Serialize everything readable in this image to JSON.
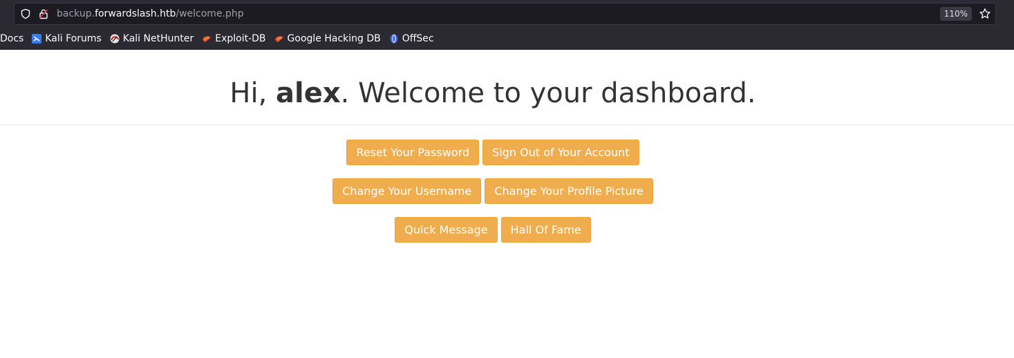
{
  "browser": {
    "url_prefix": "backup.",
    "url_host": "forwardslash.htb",
    "url_path": "/welcome.php",
    "zoom": "110%",
    "bookmarks": [
      {
        "label": "Docs",
        "icon": "none"
      },
      {
        "label": "Kali Forums",
        "icon": "kali-forums-icon"
      },
      {
        "label": "Kali NetHunter",
        "icon": "kali-nethunter-icon"
      },
      {
        "label": "Exploit-DB",
        "icon": "exploit-db-icon"
      },
      {
        "label": "Google Hacking DB",
        "icon": "ghdb-icon"
      },
      {
        "label": "OffSec",
        "icon": "offsec-icon"
      }
    ]
  },
  "page": {
    "greeting_prefix": "Hi, ",
    "username": "alex",
    "greeting_suffix": ". Welcome to your dashboard.",
    "buttons": {
      "reset_password": "Reset Your Password",
      "sign_out": "Sign Out of Your Account",
      "change_username": "Change Your Username",
      "change_profile_picture": "Change Your Profile Picture",
      "quick_message": "Quick Message",
      "hall_of_fame": "Hall Of Fame"
    }
  },
  "colors": {
    "button_warning": "#f0ad4e",
    "chrome_bg": "#2b2a33"
  }
}
